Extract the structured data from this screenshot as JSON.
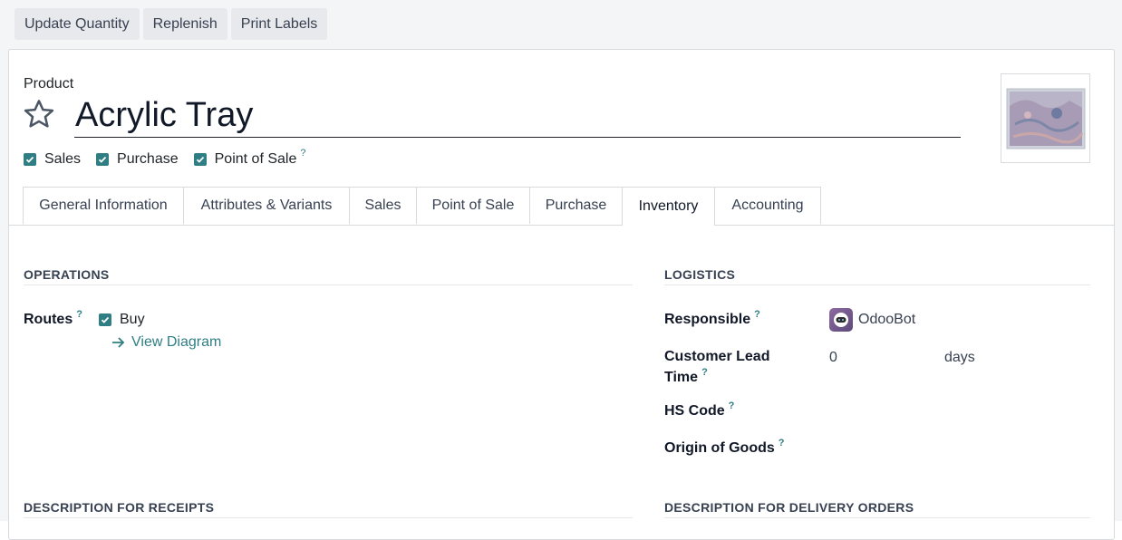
{
  "actions": {
    "update_quantity": "Update Quantity",
    "replenish": "Replenish",
    "print_labels": "Print Labels"
  },
  "product": {
    "label": "Product",
    "name": "Acrylic Tray",
    "favorite": false,
    "flags": [
      {
        "label": "Sales",
        "checked": true,
        "help": false
      },
      {
        "label": "Purchase",
        "checked": true,
        "help": false
      },
      {
        "label": "Point of Sale",
        "checked": true,
        "help": true
      }
    ]
  },
  "help_mark": "?",
  "tabs": [
    {
      "label": "General Information",
      "active": false
    },
    {
      "label": "Attributes & Variants",
      "active": false
    },
    {
      "label": "Sales",
      "active": false
    },
    {
      "label": "Point of Sale",
      "active": false
    },
    {
      "label": "Purchase",
      "active": false
    },
    {
      "label": "Inventory",
      "active": true
    },
    {
      "label": "Accounting",
      "active": false
    }
  ],
  "operations": {
    "title": "OPERATIONS",
    "routes_label": "Routes",
    "route_buy": "Buy",
    "route_buy_checked": true,
    "view_diagram": "View Diagram"
  },
  "logistics": {
    "title": "LOGISTICS",
    "responsible_label": "Responsible",
    "responsible_value": "OdooBot",
    "lead_time_label_1": "Customer Lead",
    "lead_time_label_2": "Time",
    "lead_time_value": "0",
    "lead_time_unit": "days",
    "hs_code_label": "HS Code",
    "origin_label": "Origin of Goods"
  },
  "descriptions": {
    "receipts_title": "DESCRIPTION FOR RECEIPTS",
    "delivery_title": "DESCRIPTION FOR DELIVERY ORDERS"
  },
  "colors": {
    "accent": "#2f7e84",
    "button_bg": "#e7e9ed"
  }
}
